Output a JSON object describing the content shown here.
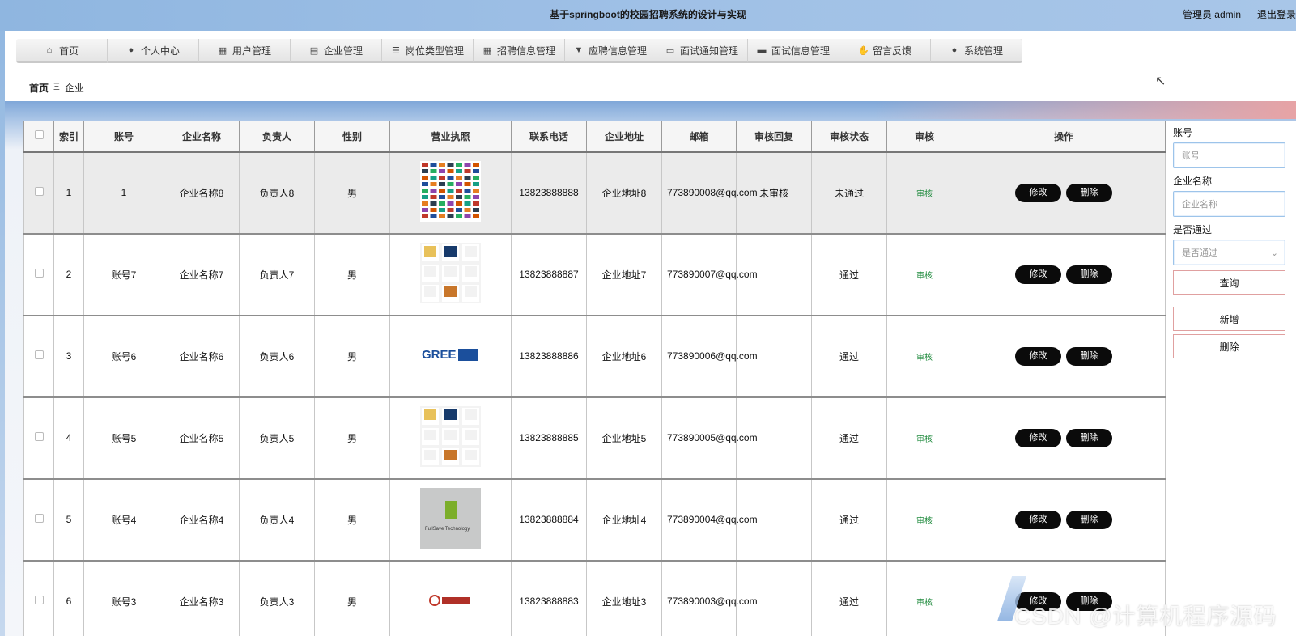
{
  "header": {
    "title": "基于springboot的校园招聘系统的设计与实现",
    "user": "管理员 admin",
    "logout": "退出登录"
  },
  "nav": [
    {
      "label": "首页",
      "icon": "home-icon",
      "glyph": "⌂"
    },
    {
      "label": "个人中心",
      "icon": "user-icon",
      "glyph": "●"
    },
    {
      "label": "用户管理",
      "icon": "grid-icon",
      "glyph": "▦"
    },
    {
      "label": "企业管理",
      "icon": "clipboard-icon",
      "glyph": "▤"
    },
    {
      "label": "岗位类型管理",
      "icon": "list-icon",
      "glyph": "☰"
    },
    {
      "label": "招聘信息管理",
      "icon": "grid-icon",
      "glyph": "▦"
    },
    {
      "label": "应聘信息管理",
      "icon": "pin-icon",
      "glyph": "▼"
    },
    {
      "label": "面试通知管理",
      "icon": "monitor-icon",
      "glyph": "▭"
    },
    {
      "label": "面试信息管理",
      "icon": "briefcase-icon",
      "glyph": "▬"
    },
    {
      "label": "留言反馈",
      "icon": "thumbs-up-icon",
      "glyph": "✋"
    },
    {
      "label": "系统管理",
      "icon": "user-icon",
      "glyph": "●"
    }
  ],
  "breadcrumb": {
    "home": "首页",
    "separator": "Ξ",
    "current": "企业"
  },
  "table": {
    "headers": [
      "索引",
      "账号",
      "企业名称",
      "负责人",
      "性别",
      "营业执照",
      "联系电话",
      "企业地址",
      "邮箱",
      "审核回复",
      "审核状态",
      "审核",
      "操作"
    ],
    "edit_label": "修改",
    "delete_label": "删除",
    "audit_label": "审核",
    "rows": [
      {
        "index": "1",
        "account": "1",
        "name": "企业名称8",
        "owner": "负责人8",
        "gender": "男",
        "phone": "13823888888",
        "address": "企业地址8",
        "email": "773890008@qq.com",
        "reply": "未审核",
        "status": "未通过",
        "licence": "logo-wall"
      },
      {
        "index": "2",
        "account": "账号7",
        "name": "企业名称7",
        "owner": "负责人7",
        "gender": "男",
        "phone": "13823888887",
        "address": "企业地址7",
        "email": "773890007@qq.com",
        "reply": "",
        "status": "通过",
        "licence": "logo-grid"
      },
      {
        "index": "3",
        "account": "账号6",
        "name": "企业名称6",
        "owner": "负责人6",
        "gender": "男",
        "phone": "13823888886",
        "address": "企业地址6",
        "email": "773890006@qq.com",
        "reply": "",
        "status": "通过",
        "licence": "gree-logo"
      },
      {
        "index": "4",
        "account": "账号5",
        "name": "企业名称5",
        "owner": "负责人5",
        "gender": "男",
        "phone": "13823888885",
        "address": "企业地址5",
        "email": "773890005@qq.com",
        "reply": "",
        "status": "通过",
        "licence": "logo-grid"
      },
      {
        "index": "5",
        "account": "账号4",
        "name": "企业名称4",
        "owner": "负责人4",
        "gender": "男",
        "phone": "13823888884",
        "address": "企业地址4",
        "email": "773890004@qq.com",
        "reply": "",
        "status": "通过",
        "licence": "fullsave-logo"
      },
      {
        "index": "6",
        "account": "账号3",
        "name": "企业名称3",
        "owner": "负责人3",
        "gender": "男",
        "phone": "13823888883",
        "address": "企业地址3",
        "email": "773890003@qq.com",
        "reply": "",
        "status": "通过",
        "licence": "baichuang-logo"
      }
    ]
  },
  "search": {
    "account_label": "账号",
    "account_placeholder": "账号",
    "name_label": "企业名称",
    "name_placeholder": "企业名称",
    "pass_label": "是否通过",
    "pass_placeholder": "是否通过",
    "query_button": "查询",
    "add_button": "新增",
    "delete_button": "删除"
  },
  "watermark": "CSDN @计算机程序源码"
}
